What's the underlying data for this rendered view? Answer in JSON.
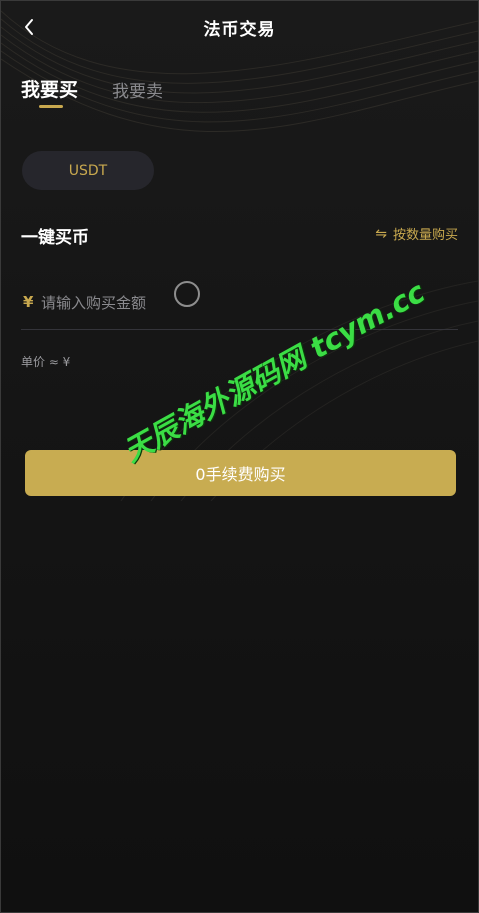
{
  "header": {
    "title": "法币交易"
  },
  "tabs": {
    "buy": "我要买",
    "sell": "我要卖"
  },
  "coin": {
    "selected": "USDT"
  },
  "section": {
    "title": "一键买币",
    "switch_label": "按数量购买",
    "switch_icon": "swap-arrows-icon"
  },
  "amount": {
    "currency_sign": "¥",
    "placeholder": "请输入购买金额",
    "value": ""
  },
  "unit_price": {
    "label": "单价 ≈ ¥"
  },
  "actions": {
    "buy_label": "0手续费购买"
  },
  "watermark": {
    "text": "天辰海外源码网 tcym.cc"
  },
  "colors": {
    "accent": "#c9a94f",
    "button": "#c8ac51",
    "background": "#151515",
    "watermark": "#3bdd45"
  }
}
